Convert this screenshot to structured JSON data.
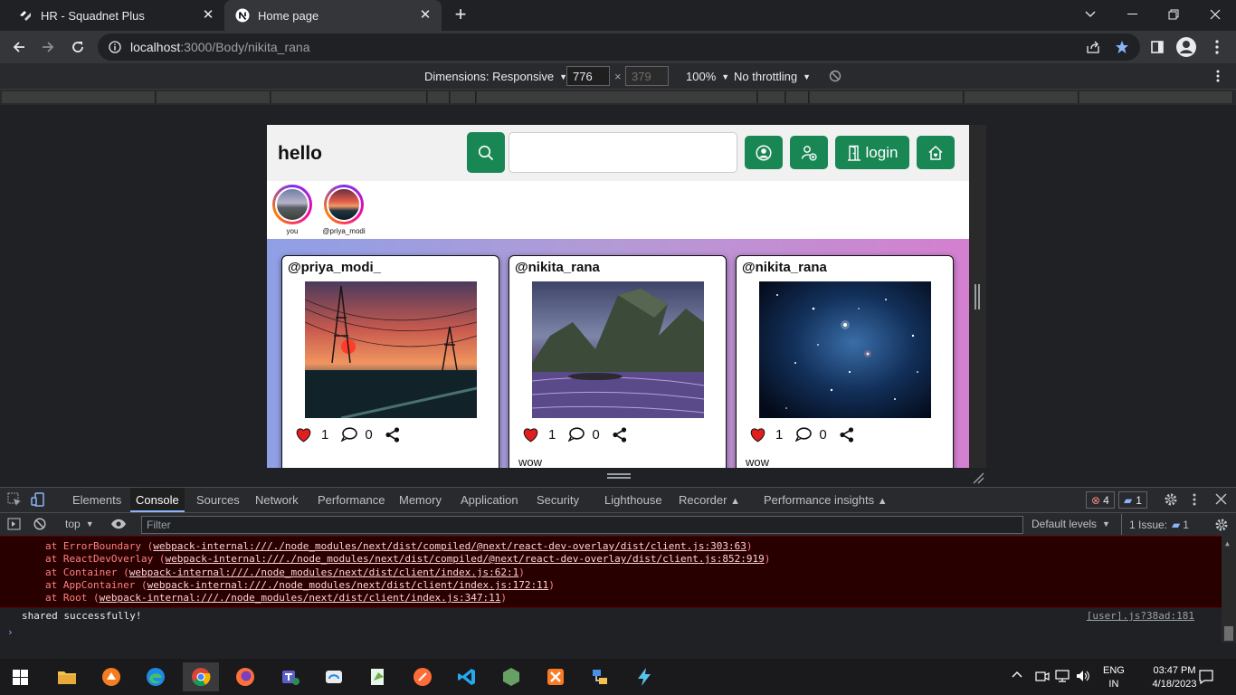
{
  "browser": {
    "tabs": [
      {
        "title": "HR - Squadnet Plus"
      },
      {
        "title": "Home page"
      }
    ],
    "url_host": "localhost",
    "url_path": ":3000/Body/nikita_rana"
  },
  "device_toolbar": {
    "dimensions_label": "Dimensions: Responsive",
    "width": "776",
    "height_placeholder": "379",
    "zoom": "100%",
    "throttling": "No throttling"
  },
  "app": {
    "brand": "hello",
    "search_placeholder": "",
    "login_label": "login",
    "stories": [
      {
        "label": "you"
      },
      {
        "label": "@priya_modi"
      }
    ],
    "posts": [
      {
        "user": "@priya_modi_",
        "likes": "1",
        "comments": "0",
        "caption": ""
      },
      {
        "user": "@nikita_rana",
        "likes": "1",
        "comments": "0",
        "caption": "wow"
      },
      {
        "user": "@nikita_rana",
        "likes": "1",
        "comments": "0",
        "caption": "wow"
      }
    ]
  },
  "devtools": {
    "tabs": [
      "Elements",
      "Console",
      "Sources",
      "Network",
      "Performance",
      "Memory",
      "Application",
      "Security",
      "Lighthouse",
      "Recorder",
      "Performance insights"
    ],
    "active_tab": "Console",
    "error_count": "4",
    "message_count": "1",
    "context": "top",
    "filter_placeholder": "Filter",
    "levels": "Default levels",
    "issues": "1 Issue:",
    "issues_count": "1",
    "stack": [
      {
        "prefix": "at ErrorBoundary (",
        "link": "webpack-internal:///./node_modules/next/dist/compiled/@next/react-dev-overlay/dist/client.js:303:63",
        "suffix": ")"
      },
      {
        "prefix": "at ReactDevOverlay (",
        "link": "webpack-internal:///./node_modules/next/dist/compiled/@next/react-dev-overlay/dist/client.js:852:919",
        "suffix": ")"
      },
      {
        "prefix": "at Container (",
        "link": "webpack-internal:///./node_modules/next/dist/client/index.js:62:1",
        "suffix": ")"
      },
      {
        "prefix": "at AppContainer (",
        "link": "webpack-internal:///./node_modules/next/dist/client/index.js:172:11",
        "suffix": ")"
      },
      {
        "prefix": "at Root (",
        "link": "webpack-internal:///./node_modules/next/dist/client/index.js:347:11",
        "suffix": ")"
      }
    ],
    "log_message": "shared successfully!",
    "log_source": "[user].js?38ad:181"
  },
  "taskbar": {
    "lang_top": "ENG",
    "lang_bottom": "IN",
    "time": "03:47 PM",
    "date": "4/18/2023"
  },
  "colors": {
    "accent_green": "#198754",
    "error_bg": "#290000",
    "chrome_dark": "#202124"
  }
}
